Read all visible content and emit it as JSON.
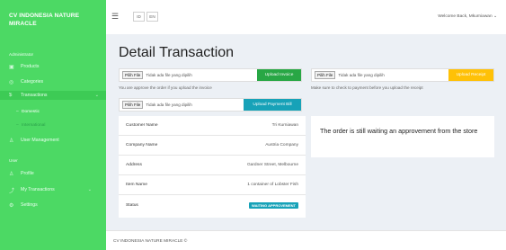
{
  "sidebar": {
    "brand": "CV INDONESIA NATURE MIRACLE",
    "section_admin": "Administrator",
    "items": [
      {
        "label": "Products",
        "icon": "box-icon"
      },
      {
        "label": "Categories",
        "icon": "tag-icon"
      },
      {
        "label": "Transactions",
        "icon": "dollar-icon"
      }
    ],
    "sub_items": [
      {
        "label": "Domestic"
      },
      {
        "label": "International"
      }
    ],
    "user_management": "User Management",
    "section_user": "User",
    "user_items": [
      {
        "label": "Profile"
      },
      {
        "label": "My Transactions"
      },
      {
        "label": "Settings"
      }
    ]
  },
  "topbar": {
    "lang_id": "ID",
    "lang_en": "EN",
    "welcome": "Welcome Back, Mkurniawan"
  },
  "main": {
    "title": "Detail Transaction",
    "choose_file": "Pilih File",
    "no_file": "Tidak ada file yang dipilih",
    "upload_invoice": "Upload Invoice",
    "invoice_help": "You are approve the order if you upload the invoice",
    "upload_payment": "Upload Payment Bill",
    "upload_receipt": "Upload Receipt",
    "receipt_help": "Make sure to check to payment before you upload the receipt",
    "details": [
      {
        "label": "Customer Name",
        "value": "Tri Kurniawan"
      },
      {
        "label": "Company Name",
        "value": "Austria Company"
      },
      {
        "label": "Address",
        "value": "Gardner Street, Melbourne"
      },
      {
        "label": "Item Name",
        "value": "1 container of Lobster Fish"
      },
      {
        "label": "Status",
        "value": "WAITING APPROVEMENT"
      }
    ],
    "waiting_message": "The order is still waiting an approvement from the store"
  },
  "footer": {
    "text": "CV INDONESIA NATURE MIRACLE ©"
  },
  "colors": {
    "sidebar": "#4cd964",
    "invoice_btn": "#28a745",
    "payment_btn": "#17a2b8",
    "receipt_btn": "#ffc107",
    "status_badge": "#17a2b8"
  }
}
